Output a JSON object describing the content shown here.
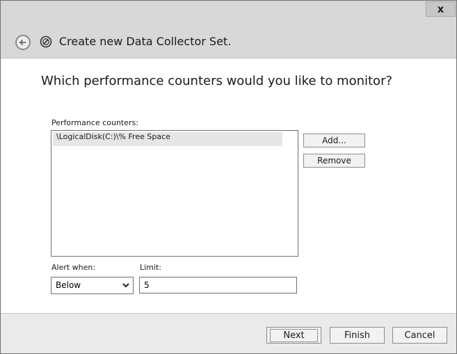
{
  "window": {
    "title": "Create new Data Collector Set.",
    "close_label": "x"
  },
  "icons": {
    "back": "back-arrow-icon",
    "wizard": "data-collector-set-icon",
    "close": "close-icon",
    "dropdown": "chevron-down-icon"
  },
  "main": {
    "heading": "Which performance counters would you like to monitor?",
    "counters_label": "Performance counters:",
    "counters": [
      "\\LogicalDisk(C:)\\% Free Space"
    ],
    "add_label": "Add...",
    "remove_label": "Remove",
    "alert_when_label": "Alert when:",
    "alert_when_value": "Below",
    "limit_label": "Limit:",
    "limit_value": "5"
  },
  "footer": {
    "next_label": "Next",
    "finish_label": "Finish",
    "cancel_label": "Cancel"
  }
}
